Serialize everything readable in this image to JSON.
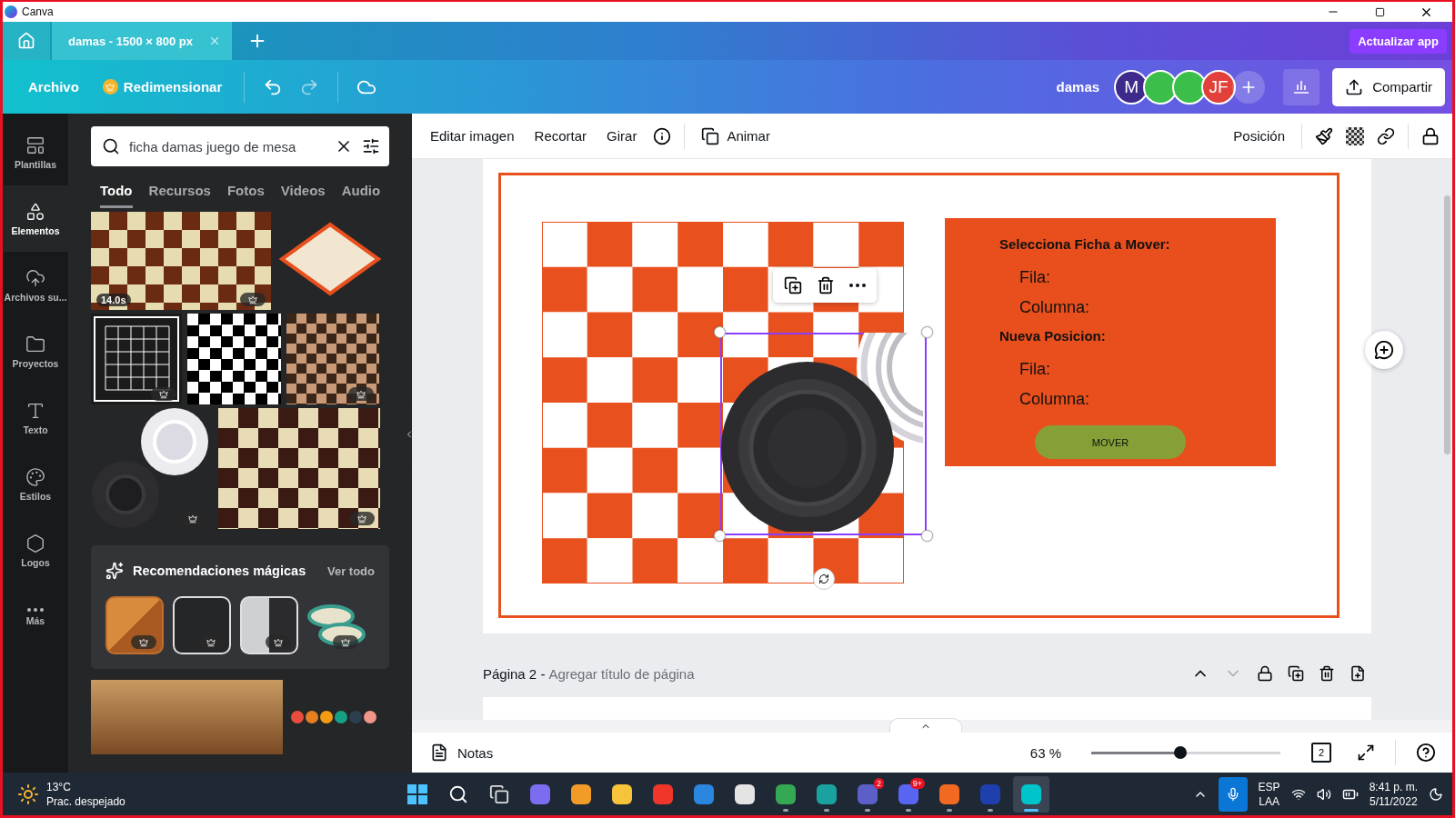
{
  "window": {
    "title": "Canva"
  },
  "tabs": [
    {
      "label": "damas - 1500 × 800 px",
      "selected": true
    }
  ],
  "upgrade_button": "Actualizar app",
  "menu": {
    "file": "Archivo",
    "resize": "Redimensionar"
  },
  "design_name": "damas",
  "collaborators": [
    {
      "kind": "letter",
      "initial": "M",
      "color": "#3d2a8a"
    },
    {
      "kind": "photo"
    },
    {
      "kind": "photo"
    },
    {
      "kind": "letter",
      "initial": "JF",
      "color": "#e2403a"
    }
  ],
  "share_button": "Compartir",
  "rail": [
    {
      "label": "Plantillas",
      "selected": false
    },
    {
      "label": "Elementos",
      "selected": true
    },
    {
      "label": "Archivos su...",
      "selected": false
    },
    {
      "label": "Proyectos",
      "selected": false
    },
    {
      "label": "Texto",
      "selected": false
    },
    {
      "label": "Estilos",
      "selected": false
    },
    {
      "label": "Logos",
      "selected": false
    },
    {
      "label": "Más",
      "selected": false
    }
  ],
  "search": {
    "value": "ficha damas juego de mesa"
  },
  "panel_tabs": [
    {
      "label": "Todo",
      "selected": true
    },
    {
      "label": "Recursos",
      "selected": false
    },
    {
      "label": "Fotos",
      "selected": false
    },
    {
      "label": "Videos",
      "selected": false
    },
    {
      "label": "Audio",
      "selected": false
    }
  ],
  "results": [
    [
      {
        "kind": "video",
        "duration": "14.0s",
        "premium": true
      },
      {
        "kind": "iso-board",
        "premium": false
      }
    ],
    [
      {
        "kind": "grid-board",
        "premium": true
      },
      {
        "kind": "checker",
        "premium": false
      },
      {
        "kind": "wavy",
        "premium": true
      }
    ],
    [
      {
        "kind": "pieces",
        "premium": true
      },
      {
        "kind": "wood-board",
        "premium": true
      }
    ]
  ],
  "magic": {
    "title": "Recomendaciones mágicas",
    "link": "Ver todo",
    "items": [
      {
        "kind": "orange",
        "premium": true
      },
      {
        "kind": "outline",
        "premium": true
      },
      {
        "kind": "grey",
        "premium": true
      },
      {
        "kind": "stack",
        "premium": true
      }
    ]
  },
  "more_results": [
    {
      "kind": "photo"
    },
    {
      "kind": "ghosts"
    }
  ],
  "context_toolbar": {
    "items": [
      "Editar imagen",
      "Recortar",
      "Girar"
    ],
    "animate": "Animar",
    "position": "Posición"
  },
  "design": {
    "lines": [
      {
        "kind": "heading",
        "text": "Selecciona Ficha a Mover:"
      },
      {
        "kind": "field",
        "text": "Fila:"
      },
      {
        "kind": "field",
        "text": "Columna:"
      },
      {
        "kind": "heading",
        "text": "Nueva Posicion:"
      },
      {
        "kind": "field",
        "text": "Fila:"
      },
      {
        "kind": "field",
        "text": "Columna:"
      }
    ],
    "button": "MOVER"
  },
  "page2": {
    "label": "Página 2 -",
    "title_placeholder": "Agregar título de página"
  },
  "bottom": {
    "notes": "Notas",
    "zoom": "63 %",
    "zoom_slider": {
      "level": 0.47
    },
    "page_count": "2"
  },
  "taskbar": {
    "temperature": "13°C",
    "weather": "Prac. despejado",
    "apps": [
      {
        "kind": "start",
        "running": false,
        "selected": false
      },
      {
        "kind": "search",
        "running": false,
        "selected": false
      },
      {
        "kind": "taskview",
        "running": false,
        "selected": false
      },
      {
        "kind": "app",
        "color": "#7b6cf0",
        "running": false,
        "selected": false
      },
      {
        "kind": "app",
        "color": "#f29b26",
        "running": false,
        "selected": false
      },
      {
        "kind": "app",
        "color": "#f7c33b",
        "running": false,
        "selected": false
      },
      {
        "kind": "app",
        "color": "#f0362b",
        "running": false,
        "selected": false
      },
      {
        "kind": "app",
        "color": "#2a86de",
        "running": false,
        "selected": false
      },
      {
        "kind": "app",
        "color": "#e4e4e4",
        "running": false,
        "selected": false
      },
      {
        "kind": "app",
        "color": "#34a853",
        "running": true,
        "selected": false
      },
      {
        "kind": "app",
        "color": "#1aa2a0",
        "running": true,
        "selected": false
      },
      {
        "kind": "app",
        "color": "#5b5fc7",
        "badge": "2",
        "running": true,
        "selected": false
      },
      {
        "kind": "app",
        "color": "#5865f2",
        "badge": "9+",
        "running": true,
        "selected": false
      },
      {
        "kind": "app",
        "color": "#f26a21",
        "running": true,
        "selected": false
      },
      {
        "kind": "app",
        "color": "#1e3fae",
        "running": true,
        "selected": false
      },
      {
        "kind": "app",
        "color": "#00c4cc",
        "running": true,
        "selected": true
      }
    ],
    "language": "ESP",
    "layout": "LAA",
    "time": "8:41 p. m.",
    "date": "5/11/2022"
  }
}
